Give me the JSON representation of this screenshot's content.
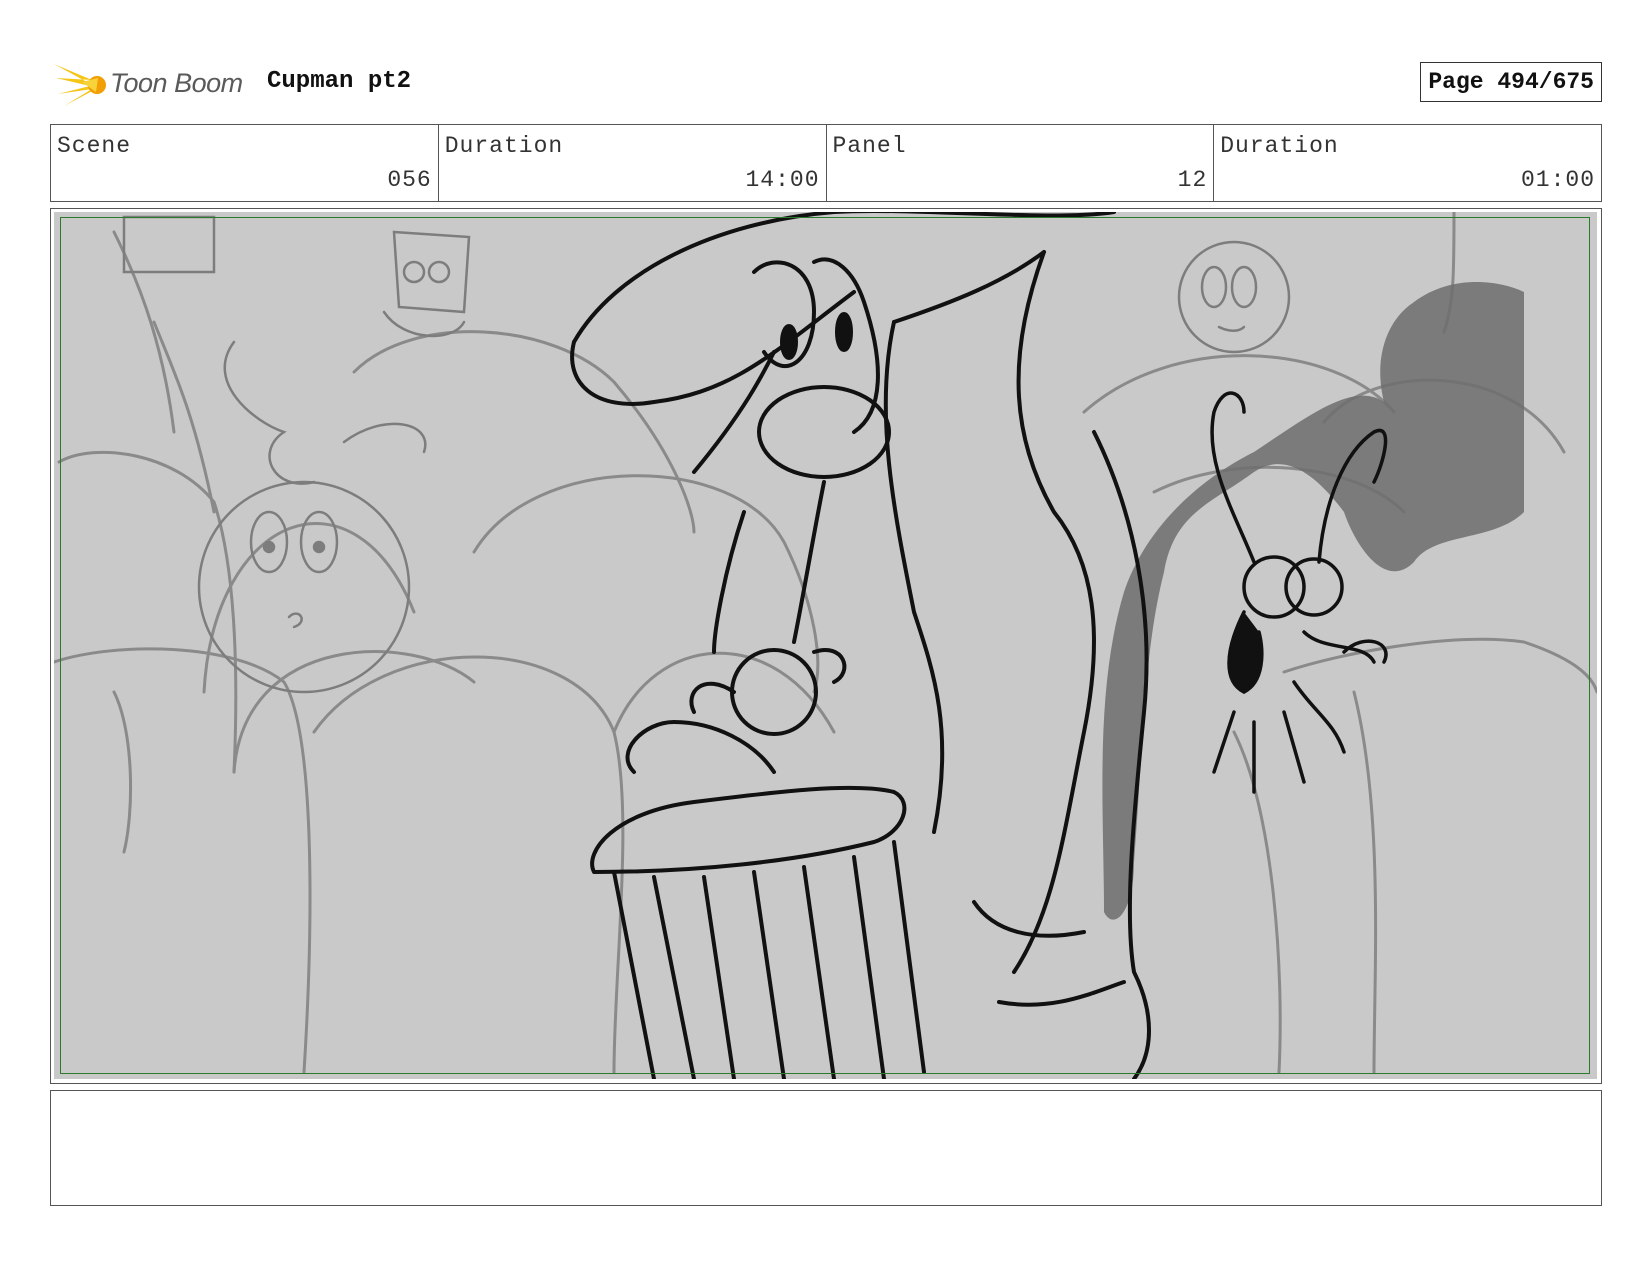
{
  "header": {
    "logo_text": "Toon Boom",
    "project_title": "Cupman pt2",
    "page_label": "Page 494/675"
  },
  "info": {
    "scene_label": "Scene",
    "scene_value": "056",
    "scene_duration_label": "Duration",
    "scene_duration_value": "14:00",
    "panel_label": "Panel",
    "panel_value": "12",
    "panel_duration_label": "Duration",
    "panel_duration_value": "01:00"
  },
  "panel": {
    "background_color": "#c9c9c9",
    "safe_frame_color": "#2d7a2d"
  },
  "notes": {
    "text": ""
  }
}
